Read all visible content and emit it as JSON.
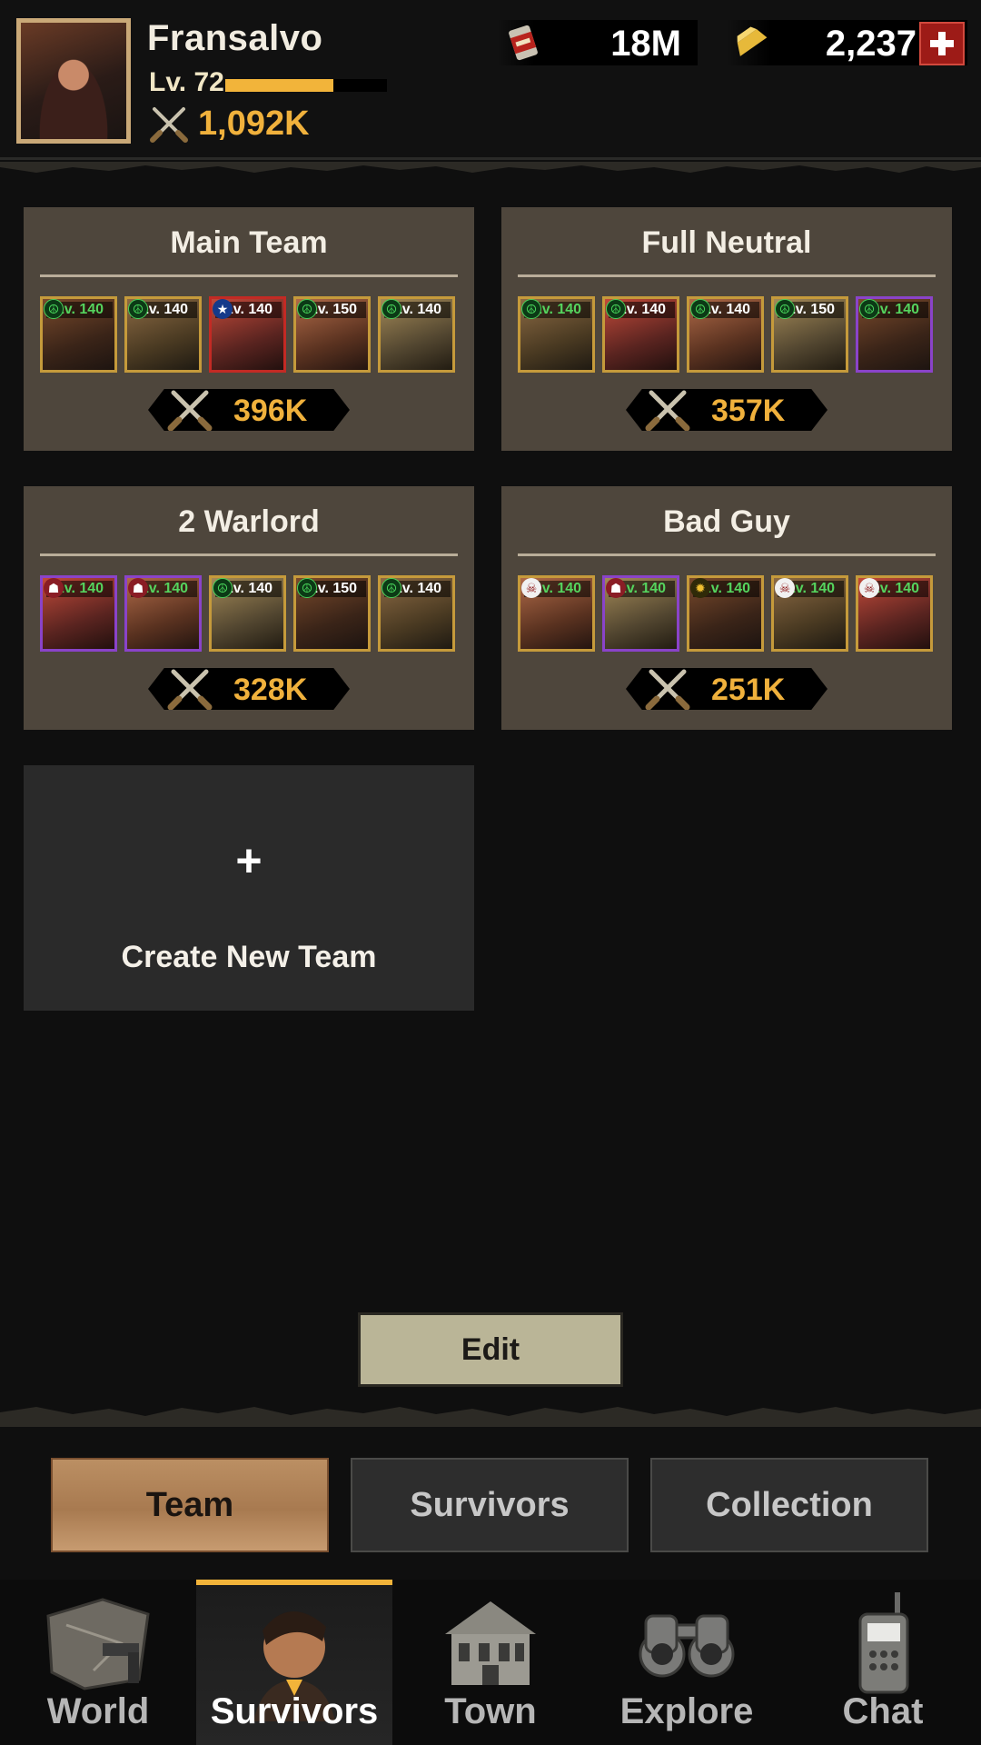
{
  "player": {
    "name": "Fransalvo",
    "level": "Lv. 72",
    "xp_fraction": 0.67,
    "power": "1,092K",
    "avatar_icon": "female-survivor-portrait"
  },
  "resources": [
    {
      "icon": "canned-food-icon",
      "value": "18M"
    },
    {
      "icon": "gold-bar-icon",
      "value": "2,237"
    }
  ],
  "teams": [
    {
      "name": "Main Team",
      "power": "396K",
      "members": [
        {
          "level": "Lv. 140",
          "faction": "peace",
          "rarity": "legendary",
          "lvl_color": "#55d45e"
        },
        {
          "level": "Lv. 140",
          "faction": "peace",
          "rarity": "legendary",
          "lvl_color": "#ffffff"
        },
        {
          "level": "Lv. 140",
          "faction": "star",
          "rarity": "mythic",
          "lvl_color": "#ffffff"
        },
        {
          "level": "Lv. 150",
          "faction": "peace",
          "rarity": "legendary",
          "lvl_color": "#ffffff"
        },
        {
          "level": "Lv. 140",
          "faction": "peace",
          "rarity": "legendary",
          "lvl_color": "#ffffff"
        }
      ]
    },
    {
      "name": "Full Neutral",
      "power": "357K",
      "members": [
        {
          "level": "Lv. 140",
          "faction": "peace",
          "rarity": "legendary",
          "lvl_color": "#55d45e"
        },
        {
          "level": "Lv. 140",
          "faction": "peace",
          "rarity": "legendary",
          "lvl_color": "#ffffff"
        },
        {
          "level": "Lv. 140",
          "faction": "peace",
          "rarity": "legendary",
          "lvl_color": "#ffffff"
        },
        {
          "level": "Lv. 150",
          "faction": "peace",
          "rarity": "legendary",
          "lvl_color": "#ffffff"
        },
        {
          "level": "Lv. 140",
          "faction": "peace",
          "rarity": "epic",
          "lvl_color": "#55d45e"
        }
      ]
    },
    {
      "name": "2 Warlord",
      "power": "328K",
      "members": [
        {
          "level": "Lv. 140",
          "faction": "warlord",
          "rarity": "epic",
          "lvl_color": "#55d45e"
        },
        {
          "level": "Lv. 140",
          "faction": "warlord",
          "rarity": "epic",
          "lvl_color": "#55d45e"
        },
        {
          "level": "Lv. 140",
          "faction": "peace",
          "rarity": "legendary",
          "lvl_color": "#ffffff"
        },
        {
          "level": "Lv. 150",
          "faction": "peace",
          "rarity": "legendary",
          "lvl_color": "#ffffff"
        },
        {
          "level": "Lv. 140",
          "faction": "peace",
          "rarity": "legendary",
          "lvl_color": "#ffffff"
        }
      ]
    },
    {
      "name": "Bad Guy",
      "power": "251K",
      "members": [
        {
          "level": "Lv. 140",
          "faction": "skull",
          "rarity": "legendary",
          "lvl_color": "#55d45e"
        },
        {
          "level": "Lv. 140",
          "faction": "warlord",
          "rarity": "epic",
          "lvl_color": "#55d45e"
        },
        {
          "level": "Lv. 140",
          "faction": "chaos",
          "rarity": "legendary",
          "lvl_color": "#55d45e"
        },
        {
          "level": "Lv. 140",
          "faction": "skull",
          "rarity": "legendary",
          "lvl_color": "#55d45e"
        },
        {
          "level": "Lv. 140",
          "faction": "skull",
          "rarity": "legendary",
          "lvl_color": "#55d45e"
        }
      ]
    }
  ],
  "create_team": {
    "plus": "+",
    "label": "Create New Team"
  },
  "edit_button": "Edit",
  "subtabs": [
    {
      "label": "Team",
      "active": true
    },
    {
      "label": "Survivors",
      "active": false
    },
    {
      "label": "Collection",
      "active": false
    }
  ],
  "nav": [
    {
      "label": "World",
      "icon": "world-map-pistol-icon",
      "active": false
    },
    {
      "label": "Survivors",
      "icon": "survivor-portrait-icon",
      "active": true
    },
    {
      "label": "Town",
      "icon": "town-building-icon",
      "active": false
    },
    {
      "label": "Explore",
      "icon": "binoculars-icon",
      "active": false
    },
    {
      "label": "Chat",
      "icon": "radio-walkie-talkie-icon",
      "active": false
    }
  ],
  "colors": {
    "accent": "#f2b43a",
    "card_bg": "#4e463c",
    "legendary_border": "#c59a3b",
    "epic_border": "#8a43c9",
    "mythic_border": "#c32a24",
    "plus_red": "#9d1b17"
  }
}
